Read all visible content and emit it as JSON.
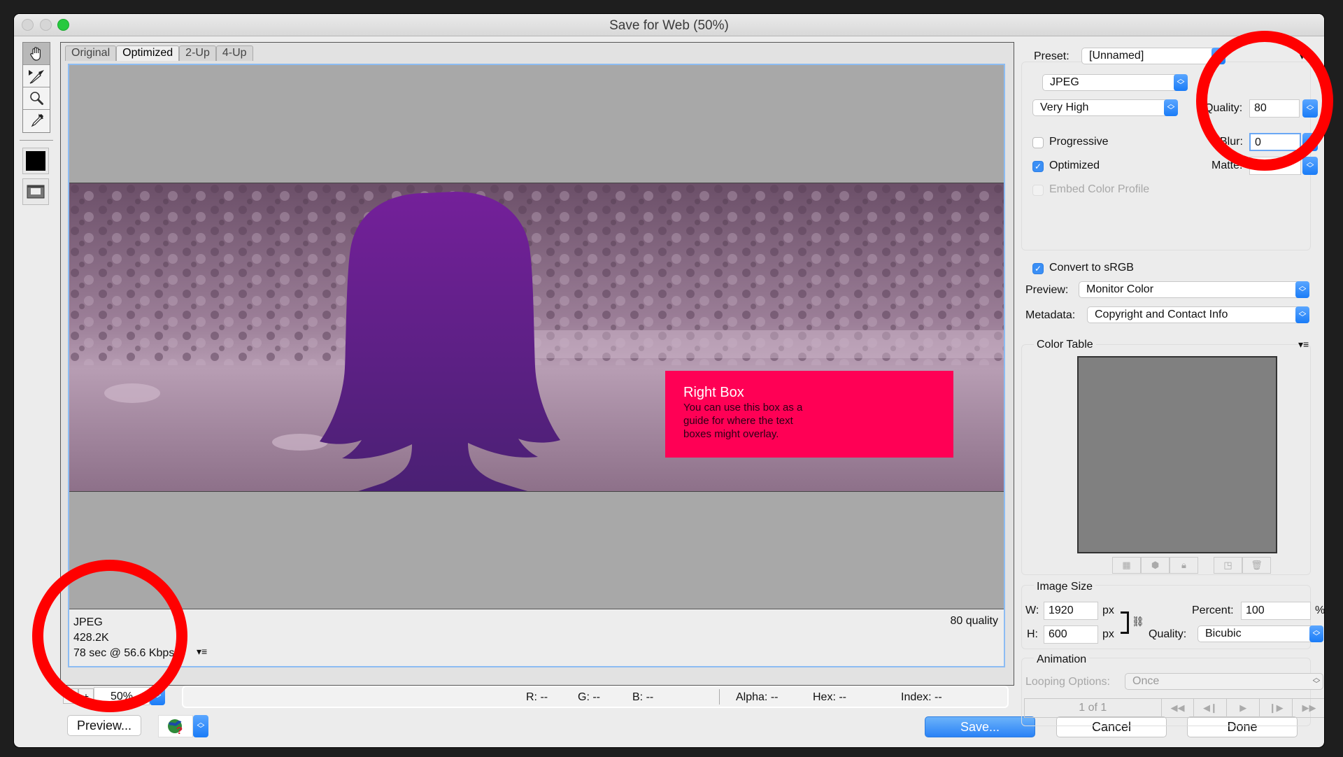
{
  "window": {
    "title": "Save for Web (50%)"
  },
  "tools": [
    {
      "name": "hand-tool",
      "icon": "hand-icon"
    },
    {
      "name": "slice-select-tool",
      "icon": "slice-select-icon"
    },
    {
      "name": "zoom-tool",
      "icon": "magnifier-icon"
    },
    {
      "name": "eyedropper-tool",
      "icon": "eyedropper-icon"
    }
  ],
  "eyedropper_color": "#000000",
  "view_tabs": [
    "Original",
    "Optimized",
    "2-Up",
    "4-Up"
  ],
  "active_tab": "Optimized",
  "preview": {
    "overlay_box": {
      "title": "Right Box",
      "text": "You can use this box as a guide for where the text boxes might overlay.",
      "color": "#ff0055"
    },
    "silhouette_color": "#6a2390"
  },
  "info": {
    "format": "JPEG",
    "file_size": "428.2K",
    "download_time": "78 sec @ 56.6 Kbps",
    "quality_note": "80 quality"
  },
  "zoom": {
    "value": "50%"
  },
  "pixel_info": {
    "r": "R: --",
    "g": "G: --",
    "b": "B: --",
    "alpha": "Alpha: --",
    "hex": "Hex: --",
    "index": "Index: --"
  },
  "buttons": {
    "preview": "Preview...",
    "save": "Save...",
    "cancel": "Cancel",
    "done": "Done"
  },
  "settings": {
    "preset_label": "Preset:",
    "preset_value": "[Unnamed]",
    "format_value": "JPEG",
    "quality_preset": "Very High",
    "quality_label": "Quality:",
    "quality_value": "80",
    "blur_label": "Blur:",
    "blur_value": "0",
    "matte_label": "Matte:",
    "progressive": {
      "label": "Progressive",
      "checked": false
    },
    "optimized": {
      "label": "Optimized",
      "checked": true
    },
    "embed_profile": {
      "label": "Embed Color Profile",
      "checked": false,
      "disabled": true
    },
    "convert_srgb": {
      "label": "Convert to sRGB",
      "checked": true
    },
    "preview_label": "Preview:",
    "preview_value": "Monitor Color",
    "metadata_label": "Metadata:",
    "metadata_value": "Copyright and Contact Info"
  },
  "color_table": {
    "title": "Color Table",
    "buttons": [
      "transparency-icon",
      "web-snap-icon",
      "lock-icon",
      "new-color-icon",
      "trash-icon"
    ]
  },
  "image_size": {
    "title": "Image Size",
    "w_label": "W:",
    "w_value": "1920",
    "h_label": "H:",
    "h_value": "600",
    "unit": "px",
    "percent_label": "Percent:",
    "percent_value": "100",
    "percent_unit": "%",
    "quality_label": "Quality:",
    "quality_value": "Bicubic"
  },
  "animation": {
    "title": "Animation",
    "looping_label": "Looping Options:",
    "looping_value": "Once",
    "frame_counter": "1 of 1"
  }
}
